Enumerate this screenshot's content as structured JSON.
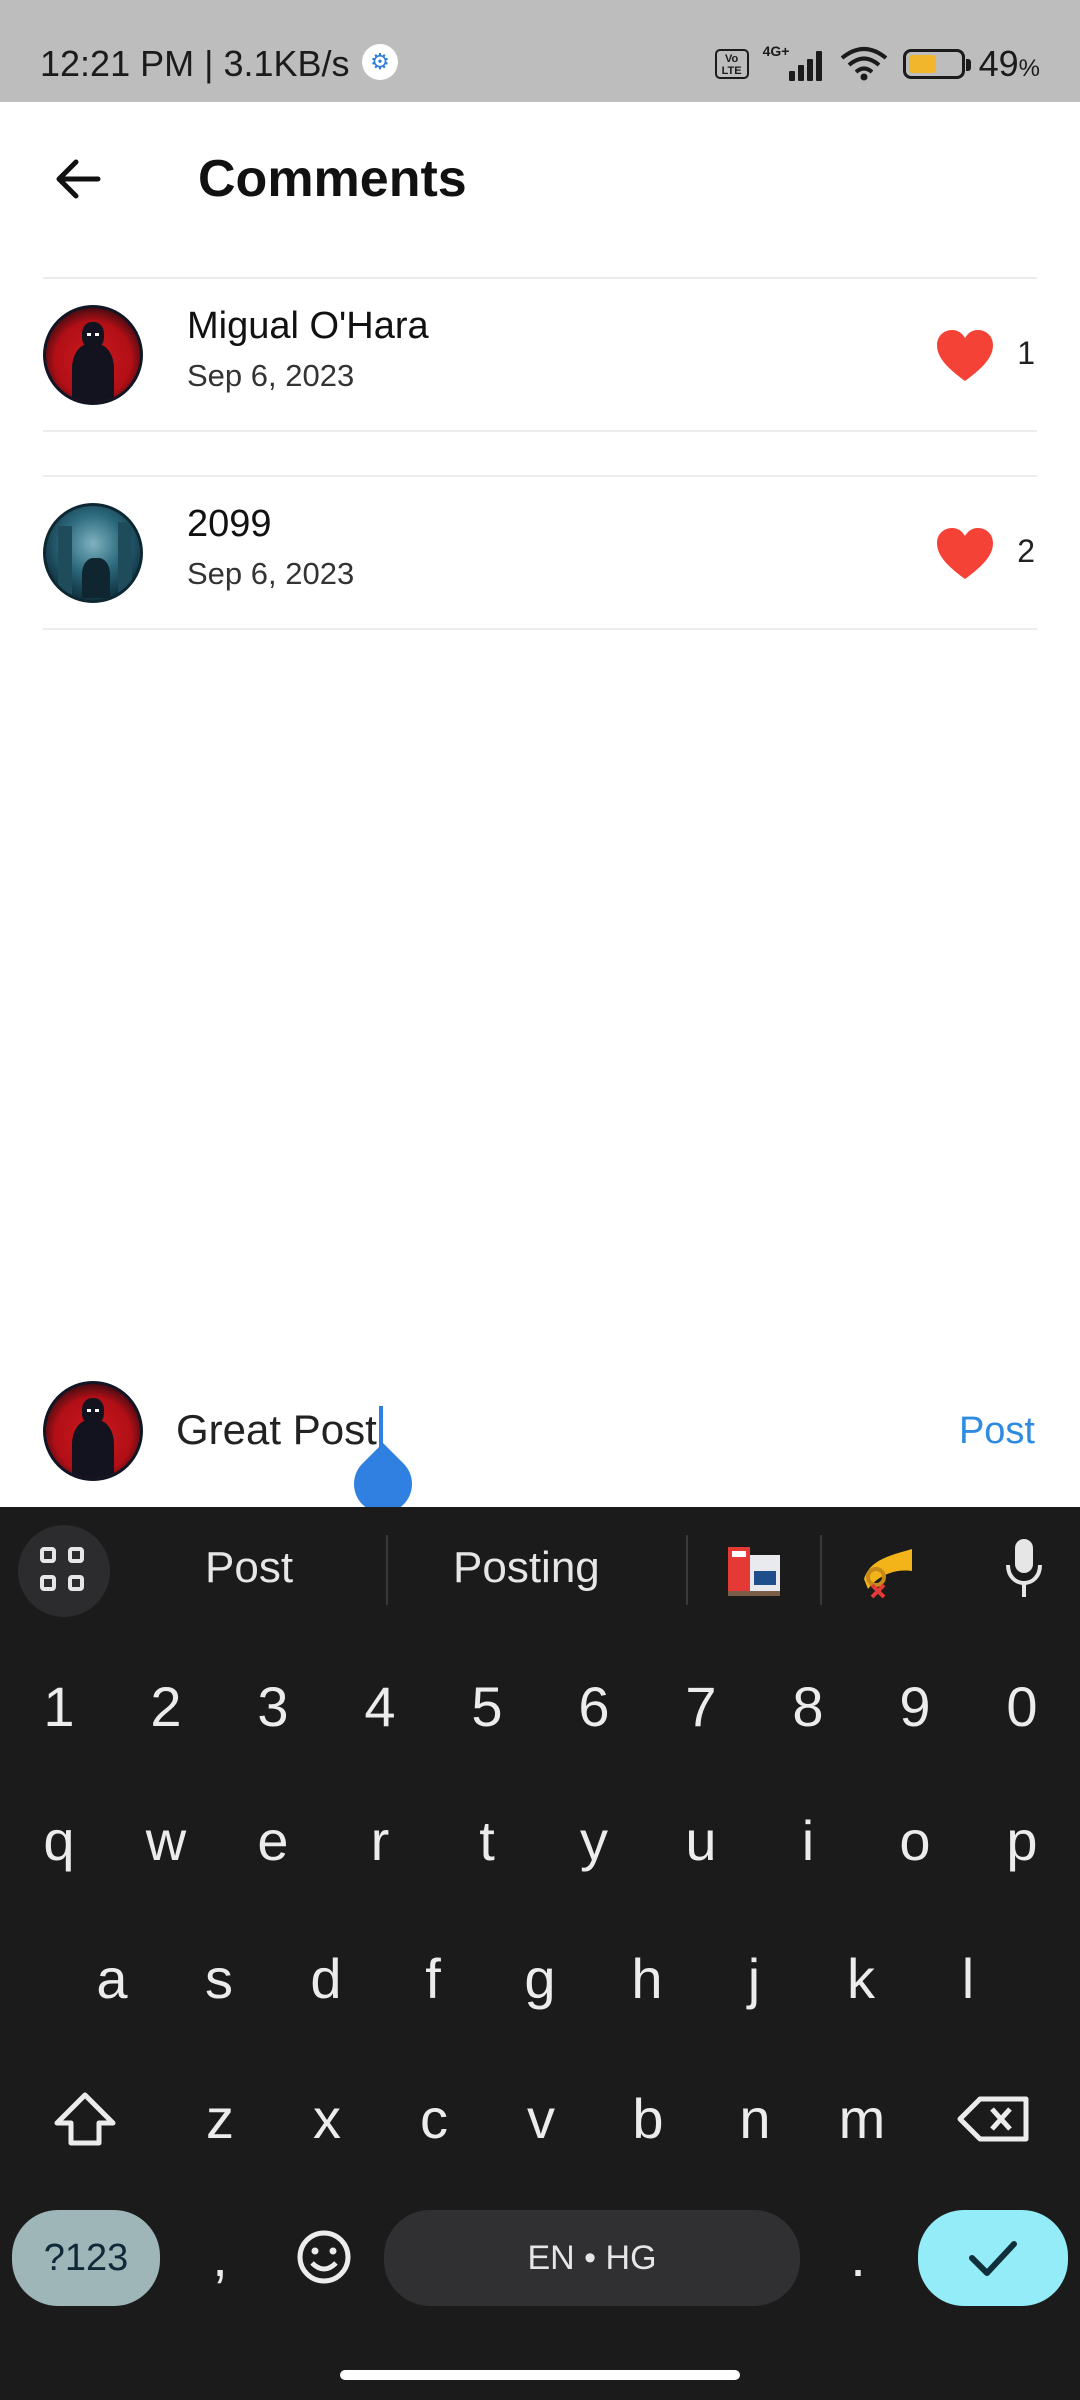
{
  "status_bar": {
    "time_speed": "12:21 PM | 3.1KB/s",
    "network": "4G+",
    "volte": "Vo LTE",
    "battery_percent": "49",
    "battery_unit": "%",
    "battery_level": 0.49,
    "battery_color": "#f2b62c"
  },
  "app_bar": {
    "back_icon": "arrow-left-icon",
    "title": "Comments"
  },
  "comments": [
    {
      "name": "Migual O'Hara",
      "date": "Sep 6, 2023",
      "likes": "1",
      "avatar": "dark-figure-red-avatar"
    },
    {
      "name": "2099",
      "date": "Sep 6, 2023",
      "likes": "2",
      "avatar": "teal-city-avatar"
    }
  ],
  "composer": {
    "value": "Great Post",
    "post_label": "Post",
    "accent": "#2f8be0"
  },
  "keyboard": {
    "suggestions": [
      "Post",
      "Posting"
    ],
    "emoji_suggestions": [
      "post-office-icon",
      "postal-horn-icon"
    ],
    "number_row": [
      "1",
      "2",
      "3",
      "4",
      "5",
      "6",
      "7",
      "8",
      "9",
      "0"
    ],
    "row1": [
      "q",
      "w",
      "e",
      "r",
      "t",
      "y",
      "u",
      "i",
      "o",
      "p"
    ],
    "row2": [
      "a",
      "s",
      "d",
      "f",
      "g",
      "h",
      "j",
      "k",
      "l"
    ],
    "row3": [
      "z",
      "x",
      "c",
      "v",
      "b",
      "n",
      "m"
    ],
    "symbols_label": "?123",
    "comma": ",",
    "space_label": "EN • HG",
    "period": ".",
    "like_color": "#f44336"
  }
}
